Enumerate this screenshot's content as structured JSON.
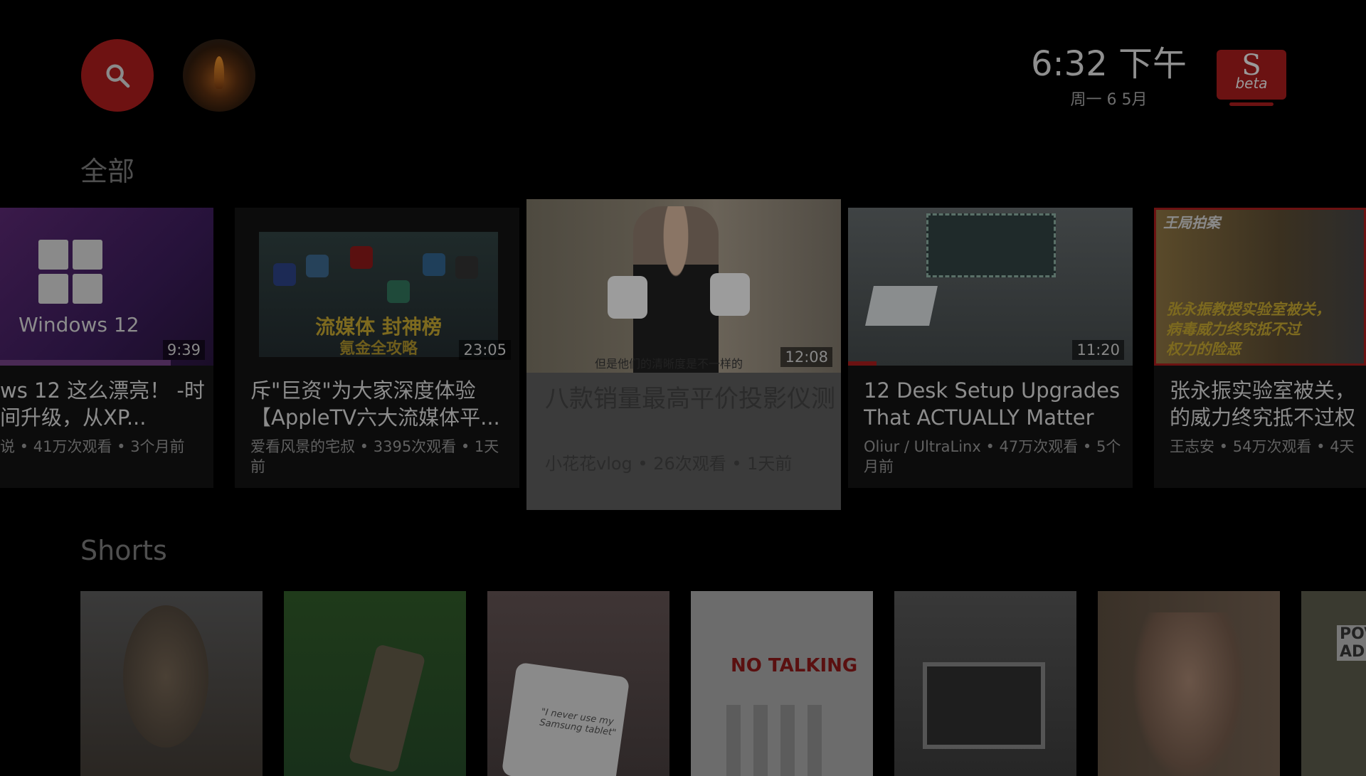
{
  "header": {
    "search_icon": "search-icon",
    "avatar_icon": "campfire-avatar",
    "clock_time": "6:32 下午",
    "clock_date": "周一 6 5月",
    "logo_letter": "S",
    "logo_badge": "beta"
  },
  "sections": {
    "all_title": "全部",
    "shorts_title": "Shorts"
  },
  "videos": [
    {
      "title": "ws 12 这么漂亮！\n-时间升级，从XP...",
      "meta": "说 • 41万次观看 • 3个月前",
      "duration": "9:39",
      "thumb_text": "Windows 12"
    },
    {
      "title": "斥\"巨资\"为大家深度体验\n【AppleTV六大流媒体平...",
      "meta": "爱看风景的宅叔 • 3395次观看 • 1天前",
      "duration": "23:05",
      "thumb_text": "流媒体 封神榜",
      "thumb_subtext": "氪金全攻略"
    },
    {
      "title": "八款销量最高平价投影仪测",
      "meta": "小花花vlog • 26次观看 • 1天前",
      "duration": "12:08",
      "thumb_text": "但是他们的清晰度是不一样的"
    },
    {
      "title": "12 Desk Setup Upgrades\nThat ACTUALLY Matter",
      "meta": "Oliur / UltraLinx • 47万次观看 • 5个月前",
      "duration": "11:20"
    },
    {
      "title": "张永振实验室被关，\n的威力终究抵不过权",
      "meta": "王志安  • 54万次观看 • 4天",
      "thumb_text": "王局拍案",
      "thumb_subtext": "张永振教授实验室被关，\n病毒威力终究抵不过\n权力的险恶"
    }
  ],
  "shorts": [
    {
      "thumb_text": ""
    },
    {
      "thumb_text": ""
    },
    {
      "thumb_text": "\"I never use my\nSamsung tablet\""
    },
    {
      "thumb_text": "NO TALKING"
    },
    {
      "thumb_text": ""
    },
    {
      "thumb_text": ""
    },
    {
      "thumb_text": "POV\nAD"
    }
  ]
}
